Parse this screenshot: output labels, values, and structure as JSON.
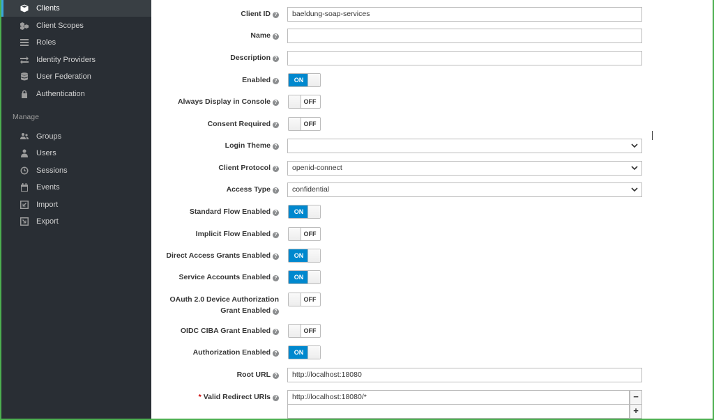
{
  "sidebar": {
    "items": [
      {
        "label": "Clients",
        "icon": "cube-icon",
        "active": true
      },
      {
        "label": "Client Scopes",
        "icon": "cubes-icon"
      },
      {
        "label": "Roles",
        "icon": "list-icon"
      },
      {
        "label": "Identity Providers",
        "icon": "exchange-icon"
      },
      {
        "label": "User Federation",
        "icon": "database-icon"
      },
      {
        "label": "Authentication",
        "icon": "lock-icon"
      }
    ],
    "section_label": "Manage",
    "manage_items": [
      {
        "label": "Groups",
        "icon": "users-icon"
      },
      {
        "label": "Users",
        "icon": "user-icon"
      },
      {
        "label": "Sessions",
        "icon": "clock-icon"
      },
      {
        "label": "Events",
        "icon": "calendar-icon"
      },
      {
        "label": "Import",
        "icon": "import-icon"
      },
      {
        "label": "Export",
        "icon": "export-icon"
      }
    ]
  },
  "form": {
    "client_id": {
      "label": "Client ID",
      "value": "baeldung-soap-services"
    },
    "name": {
      "label": "Name",
      "value": ""
    },
    "description": {
      "label": "Description",
      "value": ""
    },
    "enabled": {
      "label": "Enabled",
      "on_text": "ON",
      "state": "on"
    },
    "always_display": {
      "label": "Always Display in Console",
      "off_text": "OFF",
      "state": "off"
    },
    "consent_required": {
      "label": "Consent Required",
      "off_text": "OFF",
      "state": "off"
    },
    "login_theme": {
      "label": "Login Theme",
      "value": ""
    },
    "client_protocol": {
      "label": "Client Protocol",
      "value": "openid-connect"
    },
    "access_type": {
      "label": "Access Type",
      "value": "confidential"
    },
    "standard_flow": {
      "label": "Standard Flow Enabled",
      "on_text": "ON",
      "state": "on"
    },
    "implicit_flow": {
      "label": "Implicit Flow Enabled",
      "off_text": "OFF",
      "state": "off"
    },
    "direct_access": {
      "label": "Direct Access Grants Enabled",
      "on_text": "ON",
      "state": "on"
    },
    "service_accounts": {
      "label": "Service Accounts Enabled",
      "on_text": "ON",
      "state": "on"
    },
    "oauth_device": {
      "label_line1": "OAuth 2.0 Device Authorization",
      "label_line2": "Grant Enabled",
      "off_text": "OFF",
      "state": "off"
    },
    "oidc_ciba": {
      "label": "OIDC CIBA Grant Enabled",
      "off_text": "OFF",
      "state": "off"
    },
    "authorization": {
      "label": "Authorization Enabled",
      "on_text": "ON",
      "state": "on"
    },
    "root_url": {
      "label": "Root URL",
      "value": "http://localhost:18080"
    },
    "redirect_uris": {
      "label": "Valid Redirect URIs",
      "required_mark": "*",
      "value": "http://localhost:18080/*",
      "new_value": "",
      "remove_label": "−",
      "add_label": "+"
    }
  },
  "help_glyph": "?",
  "colors": {
    "sidebar_bg": "#292e34",
    "toggle_on": "#0088ce",
    "active_border": "#39a5dc",
    "required": "#cc0000"
  }
}
